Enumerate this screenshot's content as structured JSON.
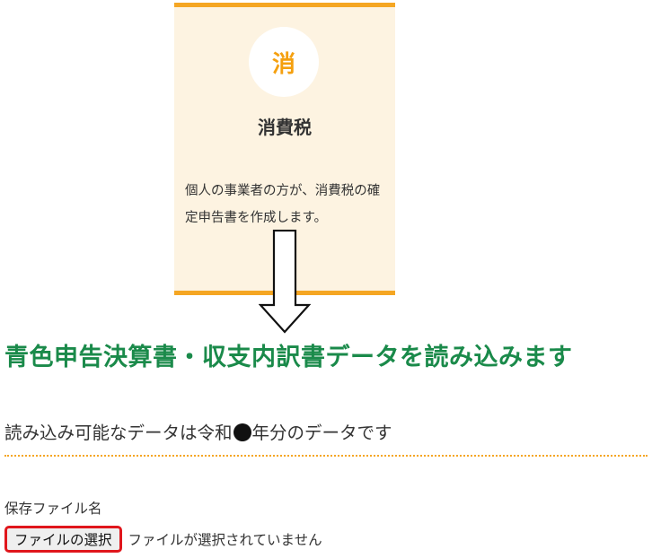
{
  "card": {
    "icon_char": "消",
    "title": "消費税",
    "description": "個人の事業者の方が、消費税の確定申告書を作成します。",
    "accent_color": "#f5a623",
    "background_color": "#fdf3e1"
  },
  "arrow": {
    "icon": "down-arrow-icon"
  },
  "main_heading": {
    "text": "青色申告決算書・収支内訳書データを読み込みます",
    "color": "#1a8a4a"
  },
  "sub_text": {
    "before": "読み込み可能なデータは令和",
    "after": "年分のデータです"
  },
  "file_section": {
    "label": "保存ファイル名",
    "button_label": "ファイルの選択",
    "status": "ファイルが選択されていません",
    "highlight_color": "#e0161c"
  }
}
